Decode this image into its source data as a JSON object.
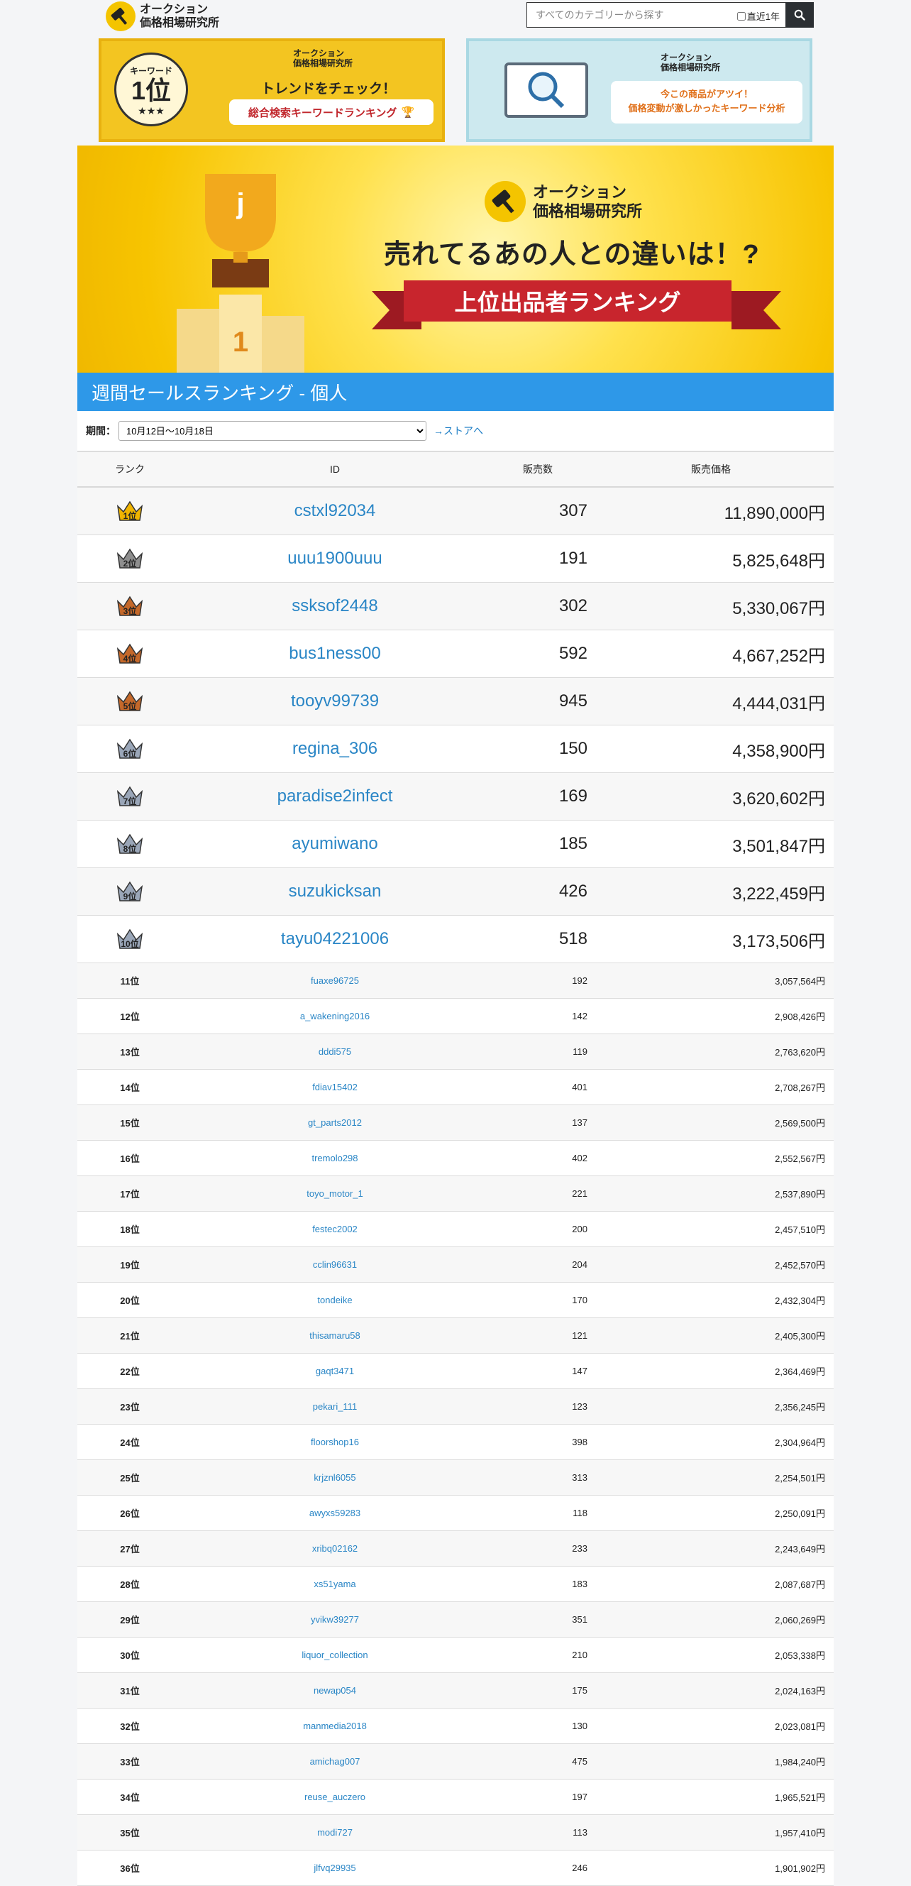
{
  "header": {
    "logo_line1": "オークション",
    "logo_line2": "価格相場研究所",
    "search_placeholder": "すべてのカテゴリーから探す",
    "recent_label": "直近1年"
  },
  "banners": {
    "left": {
      "badge_small": "キーワード",
      "badge_big": "1位",
      "logo_line1": "オークション",
      "logo_line2": "価格相場研究所",
      "headline": "トレンドをチェック！",
      "pill": "総合検索キーワードランキング"
    },
    "right": {
      "logo_line1": "オークション",
      "logo_line2": "価格相場研究所",
      "line1": "今この商品がアツイ！",
      "line2": "価格変動が激しかったキーワード分析"
    }
  },
  "hero": {
    "logo_line1": "オークション",
    "logo_line2": "価格相場研究所",
    "catch": "売れてるあの人との違いは！?",
    "ribbon": "上位出品者ランキング"
  },
  "section_title": "週間セールスランキング - 個人",
  "period": {
    "label": "期間：",
    "selected": "10月12日～10月18日",
    "store_link": "→ストアへ"
  },
  "table": {
    "headers": [
      "ランク",
      "ID",
      "販売数",
      "販売価格"
    ],
    "top_rows": [
      {
        "rank": 1,
        "crown_color": "#f0b400",
        "id": "cstxl92034",
        "sold": "307",
        "price": "11,890,000円"
      },
      {
        "rank": 2,
        "crown_color": "#8e8e8e",
        "id": "uuu1900uuu",
        "sold": "191",
        "price": "5,825,648円"
      },
      {
        "rank": 3,
        "crown_color": "#c4682a",
        "id": "ssksof2448",
        "sold": "302",
        "price": "5,330,067円"
      },
      {
        "rank": 4,
        "crown_color": "#c4682a",
        "id": "bus1ness00",
        "sold": "592",
        "price": "4,667,252円"
      },
      {
        "rank": 5,
        "crown_color": "#c4682a",
        "id": "tooyv99739",
        "sold": "945",
        "price": "4,444,031円"
      },
      {
        "rank": 6,
        "crown_color": "#9aa6b8",
        "id": "regina_306",
        "sold": "150",
        "price": "4,358,900円"
      },
      {
        "rank": 7,
        "crown_color": "#9aa6b8",
        "id": "paradise2infect",
        "sold": "169",
        "price": "3,620,602円"
      },
      {
        "rank": 8,
        "crown_color": "#9aa6b8",
        "id": "ayumiwano",
        "sold": "185",
        "price": "3,501,847円"
      },
      {
        "rank": 9,
        "crown_color": "#9aa6b8",
        "id": "suzukicksan",
        "sold": "426",
        "price": "3,222,459円"
      },
      {
        "rank": 10,
        "crown_color": "#9aa6b8",
        "id": "tayu04221006",
        "sold": "518",
        "price": "3,173,506円"
      }
    ],
    "rows": [
      {
        "rank": "11位",
        "id": "fuaxe96725",
        "sold": "192",
        "price": "3,057,564円"
      },
      {
        "rank": "12位",
        "id": "a_wakening2016",
        "sold": "142",
        "price": "2,908,426円"
      },
      {
        "rank": "13位",
        "id": "dddi575",
        "sold": "119",
        "price": "2,763,620円"
      },
      {
        "rank": "14位",
        "id": "fdiav15402",
        "sold": "401",
        "price": "2,708,267円"
      },
      {
        "rank": "15位",
        "id": "gt_parts2012",
        "sold": "137",
        "price": "2,569,500円"
      },
      {
        "rank": "16位",
        "id": "tremolo298",
        "sold": "402",
        "price": "2,552,567円"
      },
      {
        "rank": "17位",
        "id": "toyo_motor_1",
        "sold": "221",
        "price": "2,537,890円"
      },
      {
        "rank": "18位",
        "id": "festec2002",
        "sold": "200",
        "price": "2,457,510円"
      },
      {
        "rank": "19位",
        "id": "cclin96631",
        "sold": "204",
        "price": "2,452,570円"
      },
      {
        "rank": "20位",
        "id": "tondeike",
        "sold": "170",
        "price": "2,432,304円"
      },
      {
        "rank": "21位",
        "id": "thisamaru58",
        "sold": "121",
        "price": "2,405,300円"
      },
      {
        "rank": "22位",
        "id": "gaqt3471",
        "sold": "147",
        "price": "2,364,469円"
      },
      {
        "rank": "23位",
        "id": "pekari_111",
        "sold": "123",
        "price": "2,356,245円"
      },
      {
        "rank": "24位",
        "id": "floorshop16",
        "sold": "398",
        "price": "2,304,964円"
      },
      {
        "rank": "25位",
        "id": "krjznl6055",
        "sold": "313",
        "price": "2,254,501円"
      },
      {
        "rank": "26位",
        "id": "awyxs59283",
        "sold": "118",
        "price": "2,250,091円"
      },
      {
        "rank": "27位",
        "id": "xribq02162",
        "sold": "233",
        "price": "2,243,649円"
      },
      {
        "rank": "28位",
        "id": "xs51yama",
        "sold": "183",
        "price": "2,087,687円"
      },
      {
        "rank": "29位",
        "id": "yvikw39277",
        "sold": "351",
        "price": "2,060,269円"
      },
      {
        "rank": "30位",
        "id": "liquor_collection",
        "sold": "210",
        "price": "2,053,338円"
      },
      {
        "rank": "31位",
        "id": "newap054",
        "sold": "175",
        "price": "2,024,163円"
      },
      {
        "rank": "32位",
        "id": "manmedia2018",
        "sold": "130",
        "price": "2,023,081円"
      },
      {
        "rank": "33位",
        "id": "amichag007",
        "sold": "475",
        "price": "1,984,240円"
      },
      {
        "rank": "34位",
        "id": "reuse_auczero",
        "sold": "197",
        "price": "1,965,521円"
      },
      {
        "rank": "35位",
        "id": "modi727",
        "sold": "113",
        "price": "1,957,410円"
      },
      {
        "rank": "36位",
        "id": "jlfvq29935",
        "sold": "246",
        "price": "1,901,902円"
      }
    ]
  }
}
